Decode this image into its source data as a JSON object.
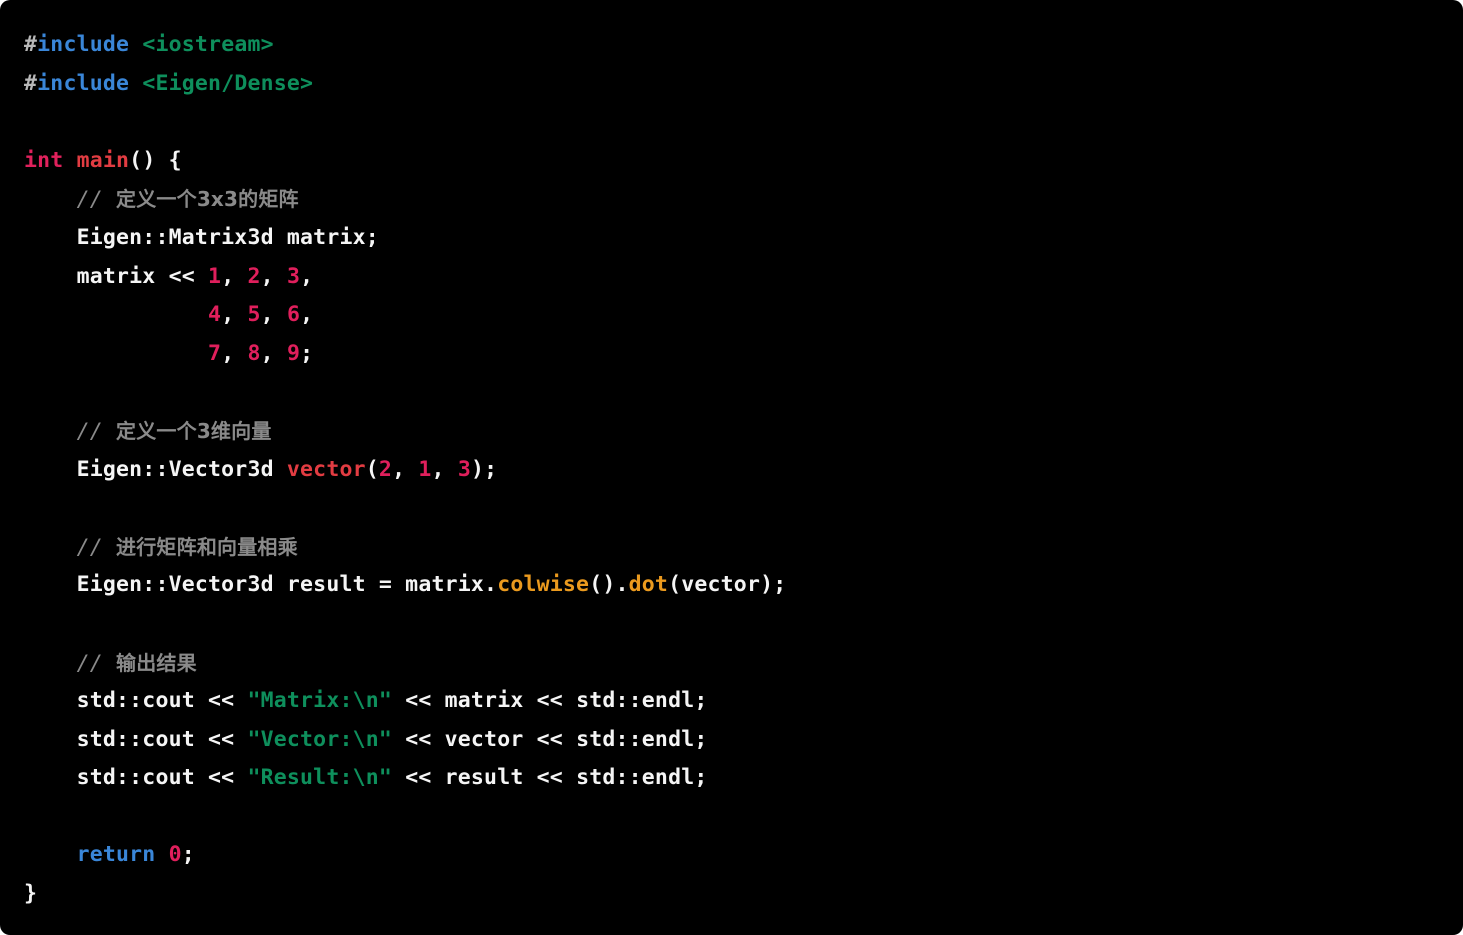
{
  "editor": {
    "language": "C++",
    "background_color": "#000000",
    "page_background_color": "#ffffff",
    "corner_radius_px": 10,
    "font_size_px": 21.5,
    "line_height_px": 38.6,
    "theme_colors": {
      "plain": "#f5f5f5",
      "preprocessor_keyword": "#3a86d8",
      "keyword": "#3a86d8",
      "hash": "#b8b8b8",
      "type": "#e0215c",
      "function": "#e23c42",
      "method": "#eb9a1e",
      "string": "#0e8f5c",
      "number": "#e01f5c",
      "comment": "#8a8a8a"
    }
  },
  "code": {
    "plain_text": "#include <iostream>\n#include <Eigen/Dense>\n\nint main() {\n    // 定义一个3x3的矩阵\n    Eigen::Matrix3d matrix;\n    matrix << 1, 2, 3,\n              4, 5, 6,\n              7, 8, 9;\n\n    // 定义一个3维向量\n    Eigen::Vector3d vector(2, 1, 3);\n\n    // 进行矩阵和向量相乘\n    Eigen::Vector3d result = matrix.colwise().dot(vector);\n\n    // 输出结果\n    std::cout << \"Matrix:\\n\" << matrix << std::endl;\n    std::cout << \"Vector:\\n\" << vector << std::endl;\n    std::cout << \"Result:\\n\" << result << std::endl;\n\n    return 0;\n}",
    "lines": [
      {
        "n": 1,
        "tokens": [
          {
            "t": "#",
            "c": "hash"
          },
          {
            "t": "include",
            "c": "preproc"
          },
          {
            "t": " ",
            "c": "plain"
          },
          {
            "t": "<iostream>",
            "c": "string"
          }
        ]
      },
      {
        "n": 2,
        "tokens": [
          {
            "t": "#",
            "c": "hash"
          },
          {
            "t": "include",
            "c": "preproc"
          },
          {
            "t": " ",
            "c": "plain"
          },
          {
            "t": "<Eigen/Dense>",
            "c": "string"
          }
        ]
      },
      {
        "n": 3,
        "tokens": []
      },
      {
        "n": 4,
        "tokens": [
          {
            "t": "int",
            "c": "type"
          },
          {
            "t": " ",
            "c": "plain"
          },
          {
            "t": "main",
            "c": "func"
          },
          {
            "t": "() {",
            "c": "punct"
          }
        ]
      },
      {
        "n": 5,
        "tokens": [
          {
            "t": "    ",
            "c": "plain"
          },
          {
            "t": "// 定义一个3x3的矩阵",
            "c": "comment"
          }
        ]
      },
      {
        "n": 6,
        "tokens": [
          {
            "t": "    Eigen::Matrix3d matrix;",
            "c": "plain"
          }
        ]
      },
      {
        "n": 7,
        "tokens": [
          {
            "t": "    matrix << ",
            "c": "plain"
          },
          {
            "t": "1",
            "c": "number"
          },
          {
            "t": ", ",
            "c": "punct"
          },
          {
            "t": "2",
            "c": "number"
          },
          {
            "t": ", ",
            "c": "punct"
          },
          {
            "t": "3",
            "c": "number"
          },
          {
            "t": ",",
            "c": "punct"
          }
        ]
      },
      {
        "n": 8,
        "tokens": [
          {
            "t": "              ",
            "c": "plain"
          },
          {
            "t": "4",
            "c": "number"
          },
          {
            "t": ", ",
            "c": "punct"
          },
          {
            "t": "5",
            "c": "number"
          },
          {
            "t": ", ",
            "c": "punct"
          },
          {
            "t": "6",
            "c": "number"
          },
          {
            "t": ",",
            "c": "punct"
          }
        ]
      },
      {
        "n": 9,
        "tokens": [
          {
            "t": "              ",
            "c": "plain"
          },
          {
            "t": "7",
            "c": "number"
          },
          {
            "t": ", ",
            "c": "punct"
          },
          {
            "t": "8",
            "c": "number"
          },
          {
            "t": ", ",
            "c": "punct"
          },
          {
            "t": "9",
            "c": "number"
          },
          {
            "t": ";",
            "c": "punct"
          }
        ]
      },
      {
        "n": 10,
        "tokens": []
      },
      {
        "n": 11,
        "tokens": [
          {
            "t": "    ",
            "c": "plain"
          },
          {
            "t": "// 定义一个3维向量",
            "c": "comment"
          }
        ]
      },
      {
        "n": 12,
        "tokens": [
          {
            "t": "    Eigen::Vector3d ",
            "c": "plain"
          },
          {
            "t": "vector",
            "c": "func"
          },
          {
            "t": "(",
            "c": "punct"
          },
          {
            "t": "2",
            "c": "number"
          },
          {
            "t": ", ",
            "c": "punct"
          },
          {
            "t": "1",
            "c": "number"
          },
          {
            "t": ", ",
            "c": "punct"
          },
          {
            "t": "3",
            "c": "number"
          },
          {
            "t": ");",
            "c": "punct"
          }
        ]
      },
      {
        "n": 13,
        "tokens": []
      },
      {
        "n": 14,
        "tokens": [
          {
            "t": "    ",
            "c": "plain"
          },
          {
            "t": "// 进行矩阵和向量相乘",
            "c": "comment"
          }
        ]
      },
      {
        "n": 15,
        "tokens": [
          {
            "t": "    Eigen::Vector3d result = matrix.",
            "c": "plain"
          },
          {
            "t": "colwise",
            "c": "method"
          },
          {
            "t": "().",
            "c": "punct"
          },
          {
            "t": "dot",
            "c": "method"
          },
          {
            "t": "(vector);",
            "c": "punct"
          }
        ]
      },
      {
        "n": 16,
        "tokens": []
      },
      {
        "n": 17,
        "tokens": [
          {
            "t": "    ",
            "c": "plain"
          },
          {
            "t": "// 输出结果",
            "c": "comment"
          }
        ]
      },
      {
        "n": 18,
        "tokens": [
          {
            "t": "    std::cout << ",
            "c": "plain"
          },
          {
            "t": "\"Matrix:\\n\"",
            "c": "string"
          },
          {
            "t": " << matrix << std::endl;",
            "c": "plain"
          }
        ]
      },
      {
        "n": 19,
        "tokens": [
          {
            "t": "    std::cout << ",
            "c": "plain"
          },
          {
            "t": "\"Vector:\\n\"",
            "c": "string"
          },
          {
            "t": " << vector << std::endl;",
            "c": "plain"
          }
        ]
      },
      {
        "n": 20,
        "tokens": [
          {
            "t": "    std::cout << ",
            "c": "plain"
          },
          {
            "t": "\"Result:\\n\"",
            "c": "string"
          },
          {
            "t": " << result << std::endl;",
            "c": "plain"
          }
        ]
      },
      {
        "n": 21,
        "tokens": []
      },
      {
        "n": 22,
        "tokens": [
          {
            "t": "    ",
            "c": "plain"
          },
          {
            "t": "return",
            "c": "keyword"
          },
          {
            "t": " ",
            "c": "plain"
          },
          {
            "t": "0",
            "c": "number"
          },
          {
            "t": ";",
            "c": "punct"
          }
        ]
      },
      {
        "n": 23,
        "tokens": [
          {
            "t": "}",
            "c": "punct"
          }
        ]
      }
    ]
  }
}
